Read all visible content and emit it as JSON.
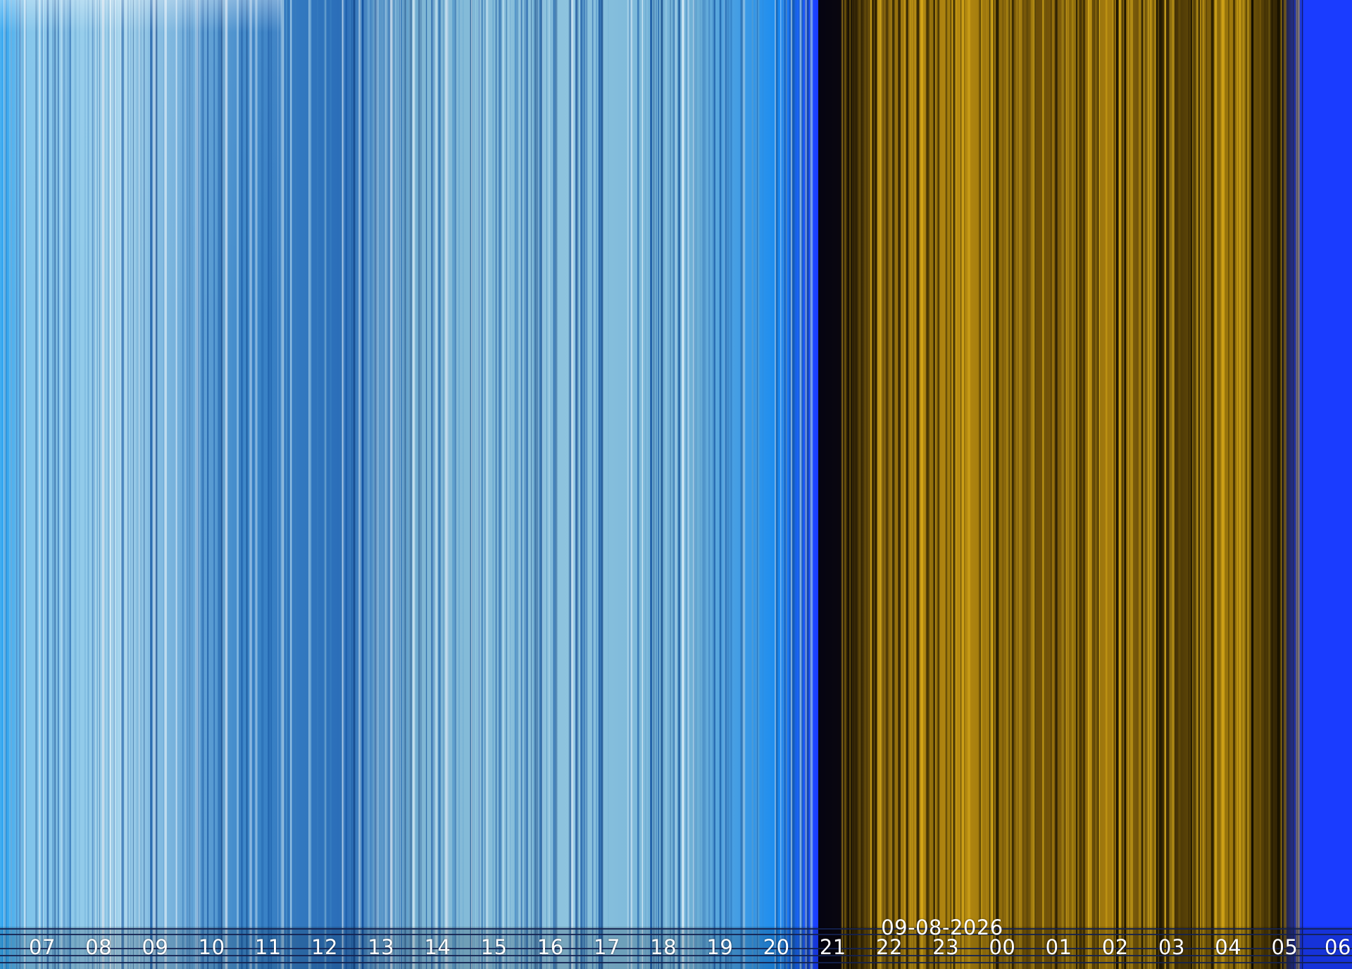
{
  "image": {
    "date_stamp": "09-08-2026",
    "hour_labels": [
      "07",
      "08",
      "09",
      "10",
      "11",
      "12",
      "13",
      "14",
      "15",
      "16",
      "17",
      "18",
      "19",
      "20",
      "21",
      "22",
      "23",
      "00",
      "01",
      "02",
      "03",
      "04",
      "05",
      "06"
    ],
    "colors": {
      "day_light": "#a9d6ec",
      "day_mid": "#6fb0d6",
      "day_dark": "#1d5fa8",
      "dusk_blue": "#1a3cff",
      "night_gold": "#b58a10",
      "night_dark": "#1a1200",
      "dawn_blue": "#1a3cff",
      "label_text": "#ffffff"
    }
  }
}
